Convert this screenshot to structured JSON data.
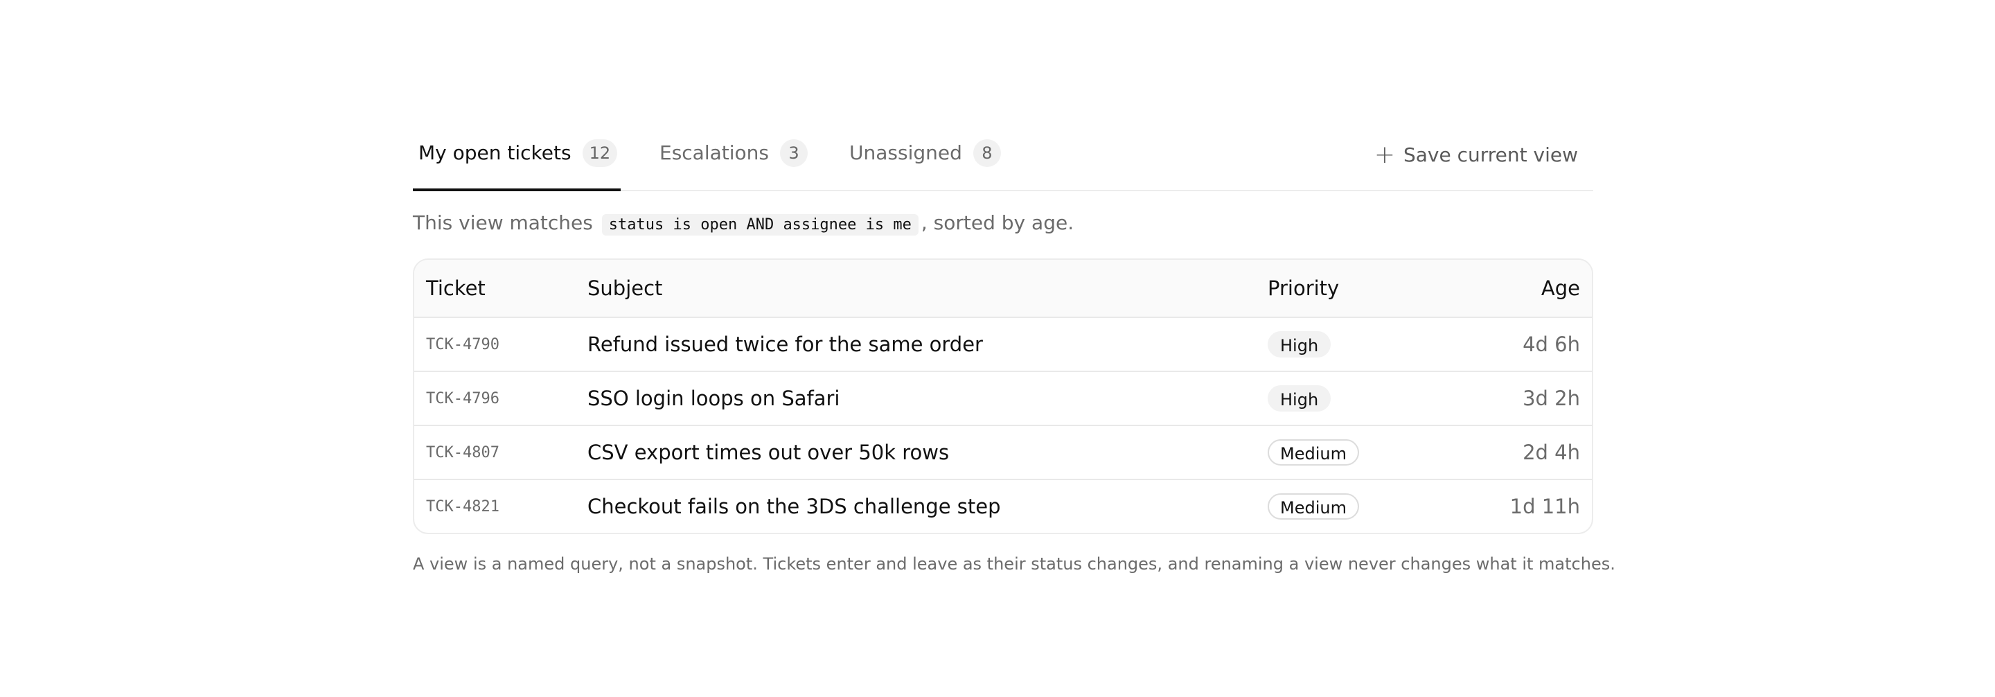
{
  "tabs": [
    {
      "label": "My open tickets",
      "count": "12",
      "active": true
    },
    {
      "label": "Escalations",
      "count": "3",
      "active": false
    },
    {
      "label": "Unassigned",
      "count": "8",
      "active": false
    }
  ],
  "save_view": {
    "label": "Save current view",
    "icon": "plus-icon"
  },
  "description": {
    "prefix": "This view matches",
    "query": "status is open AND assignee is me",
    "suffix": ", sorted by age."
  },
  "table": {
    "headers": {
      "ticket": "Ticket",
      "subject": "Subject",
      "priority": "Priority",
      "age": "Age"
    },
    "rows": [
      {
        "id": "TCK-4790",
        "subject": "Refund issued twice for the same order",
        "priority": "High",
        "age": "4d 6h"
      },
      {
        "id": "TCK-4796",
        "subject": "SSO login loops on Safari",
        "priority": "High",
        "age": "3d 2h"
      },
      {
        "id": "TCK-4807",
        "subject": "CSV export times out over 50k rows",
        "priority": "Medium",
        "age": "2d 4h"
      },
      {
        "id": "TCK-4821",
        "subject": "Checkout fails on the 3DS challenge step",
        "priority": "Medium",
        "age": "1d 11h"
      }
    ]
  },
  "footnote": "A view is a named query, not a snapshot. Tickets enter and leave as their status changes, and renaming a view never changes what it matches."
}
